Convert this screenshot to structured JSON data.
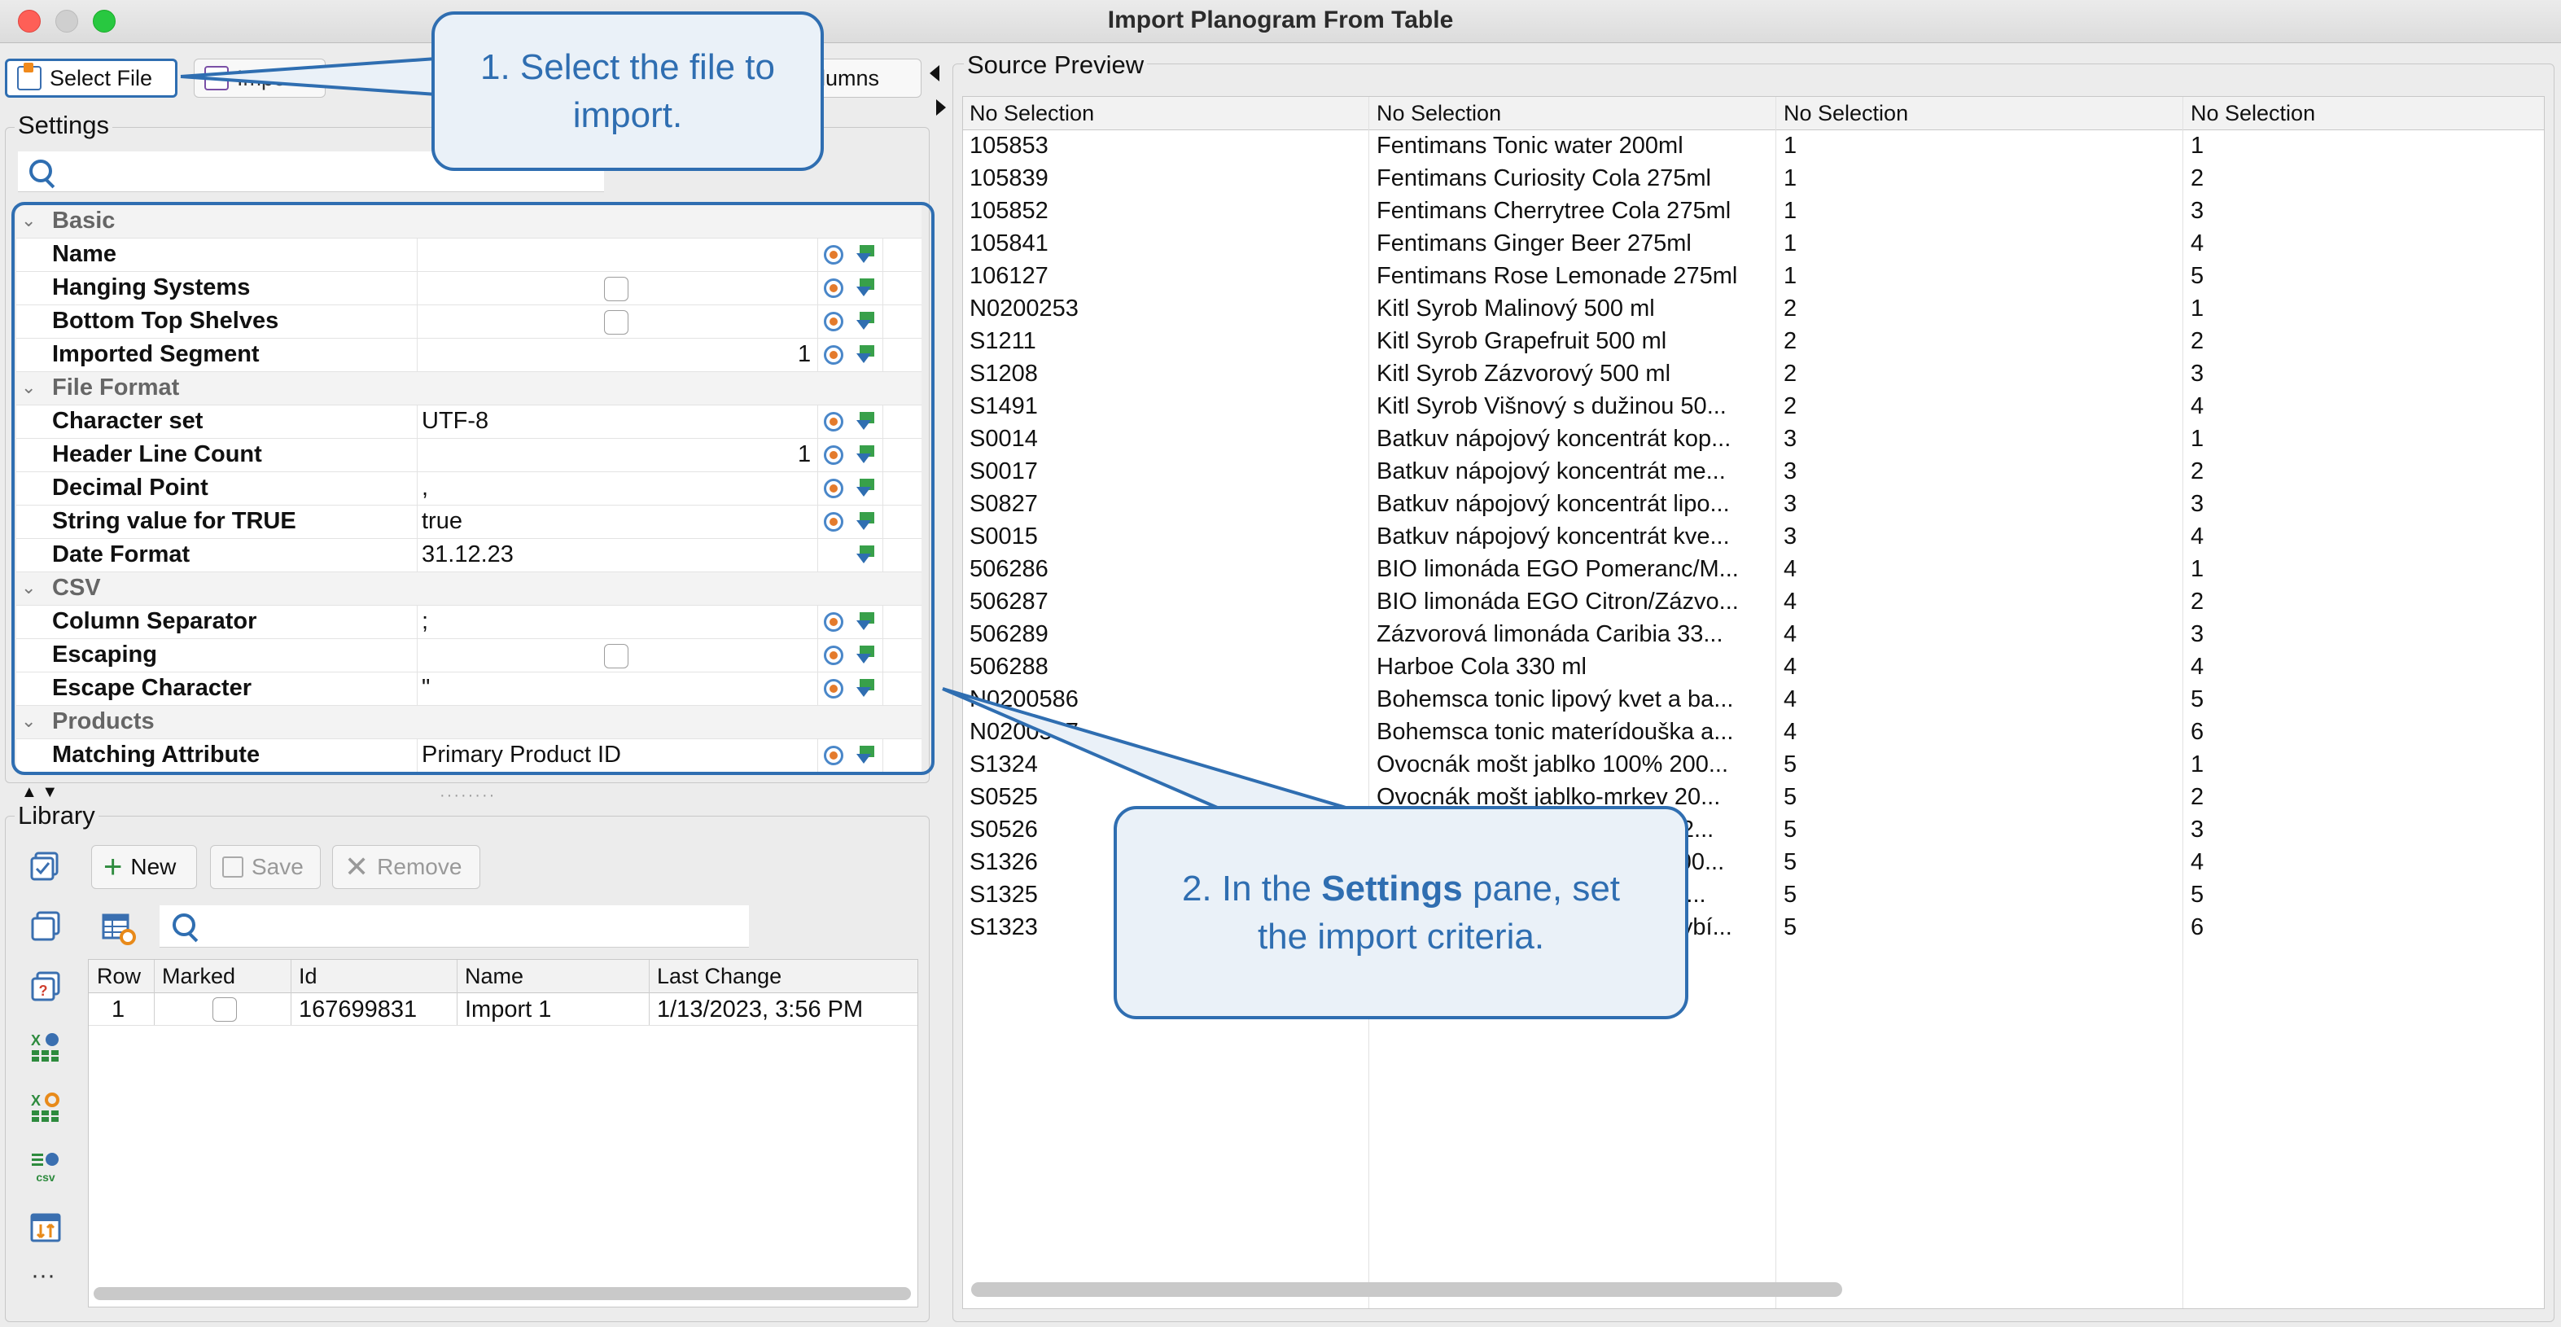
{
  "window": {
    "title": "Import Planogram From Table"
  },
  "toolbar": {
    "select_file": "Select File",
    "import": "Import",
    "columns": "olumns"
  },
  "settings": {
    "label": "Settings",
    "sections": [
      {
        "name": "Basic",
        "rows": [
          {
            "name": "Name",
            "kind": "text",
            "value": ""
          },
          {
            "name": "Hanging Systems",
            "kind": "checkbox",
            "value": ""
          },
          {
            "name": "Bottom Top Shelves",
            "kind": "checkbox",
            "value": ""
          },
          {
            "name": "Imported Segment",
            "kind": "number",
            "value": "1"
          }
        ]
      },
      {
        "name": "File Format",
        "rows": [
          {
            "name": "Character set",
            "kind": "text",
            "value": "UTF-8"
          },
          {
            "name": "Header Line Count",
            "kind": "number",
            "value": "1"
          },
          {
            "name": "Decimal Point",
            "kind": "text",
            "value": ","
          },
          {
            "name": "String value for TRUE",
            "kind": "text",
            "value": "true"
          },
          {
            "name": "Date Format",
            "kind": "text",
            "value": "31.12.23"
          }
        ]
      },
      {
        "name": "CSV",
        "rows": [
          {
            "name": "Column Separator",
            "kind": "text",
            "value": ";"
          },
          {
            "name": "Escaping",
            "kind": "checkbox",
            "value": ""
          },
          {
            "name": "Escape Character",
            "kind": "text",
            "value": "\""
          }
        ]
      },
      {
        "name": "Products",
        "rows": [
          {
            "name": "Matching Attribute",
            "kind": "text",
            "value": "Primary Product ID"
          }
        ]
      }
    ]
  },
  "library": {
    "label": "Library",
    "new": "New",
    "save": "Save",
    "remove": "Remove",
    "columns": [
      "Row",
      "Marked",
      "Id",
      "Name",
      "Last Change"
    ],
    "rows": [
      {
        "row": "1",
        "id": "167699831",
        "name": "Import 1",
        "last_change": "1/13/2023, 3:56 PM"
      }
    ]
  },
  "preview": {
    "label": "Source Preview",
    "columns": [
      "No Selection",
      "No Selection",
      "No Selection",
      "No Selection"
    ],
    "rows": [
      [
        "105853",
        "Fentimans Tonic water 200ml",
        "1",
        "1"
      ],
      [
        "105839",
        "Fentimans Curiosity Cola 275ml",
        "1",
        "2"
      ],
      [
        "105852",
        "Fentimans Cherrytree Cola 275ml",
        "1",
        "3"
      ],
      [
        "105841",
        "Fentimans Ginger Beer 275ml",
        "1",
        "4"
      ],
      [
        "106127",
        "Fentimans Rose Lemonade 275ml",
        "1",
        "5"
      ],
      [
        "N0200253",
        "Kitl Syrob Malinový 500 ml",
        "2",
        "1"
      ],
      [
        "S1211",
        "Kitl Syrob Grapefruit 500 ml",
        "2",
        "2"
      ],
      [
        "S1208",
        "Kitl Syrob Zázvorový 500 ml",
        "2",
        "3"
      ],
      [
        "S1491",
        "Kitl Syrob Višnový s dužinou 50...",
        "2",
        "4"
      ],
      [
        "S0014",
        "Batkuv nápojový koncentrát kop...",
        "3",
        "1"
      ],
      [
        "S0017",
        "Batkuv nápojový koncentrát me...",
        "3",
        "2"
      ],
      [
        "S0827",
        "Batkuv nápojový koncentrát lipo...",
        "3",
        "3"
      ],
      [
        "S0015",
        "Batkuv nápojový koncentrát kve...",
        "3",
        "4"
      ],
      [
        "506286",
        "BIO limonáda EGO Pomeranc/M...",
        "4",
        "1"
      ],
      [
        "506287",
        "BIO limonáda EGO Citron/Zázvo...",
        "4",
        "2"
      ],
      [
        "506289",
        "Zázvorová limonáda Caribia 33...",
        "4",
        "3"
      ],
      [
        "506288",
        "Harboe Cola 330 ml",
        "4",
        "4"
      ],
      [
        "N0200586",
        "Bohemsca tonic lipový kvet a ba...",
        "4",
        "5"
      ],
      [
        "N0200587",
        "Bohemsca tonic materídouška a...",
        "4",
        "6"
      ],
      [
        "S1324",
        "Ovocnák mošt jablko 100% 200...",
        "5",
        "1"
      ],
      [
        "S0525",
        "Ovocnák mošt jablko-mrkev 20...",
        "5",
        "2"
      ],
      [
        "S0526",
        "Ovocnák mošt jablko-hruška 2...",
        "5",
        "3"
      ],
      [
        "S1326",
        "Ovocnák mošt jablko-višen 100...",
        "5",
        "4"
      ],
      [
        "S1325",
        "Ovocnák mošt jablko-zelená r...",
        "5",
        "5"
      ],
      [
        "S1323",
        "Ovocnák mošt jablko-čierný rybí...",
        "5",
        "6"
      ]
    ]
  },
  "callouts": {
    "step1": "1. Select the file to import.",
    "step2_pre": "2. In the ",
    "step2_bold": "Settings",
    "step2_post": " pane, set the import criteria."
  }
}
